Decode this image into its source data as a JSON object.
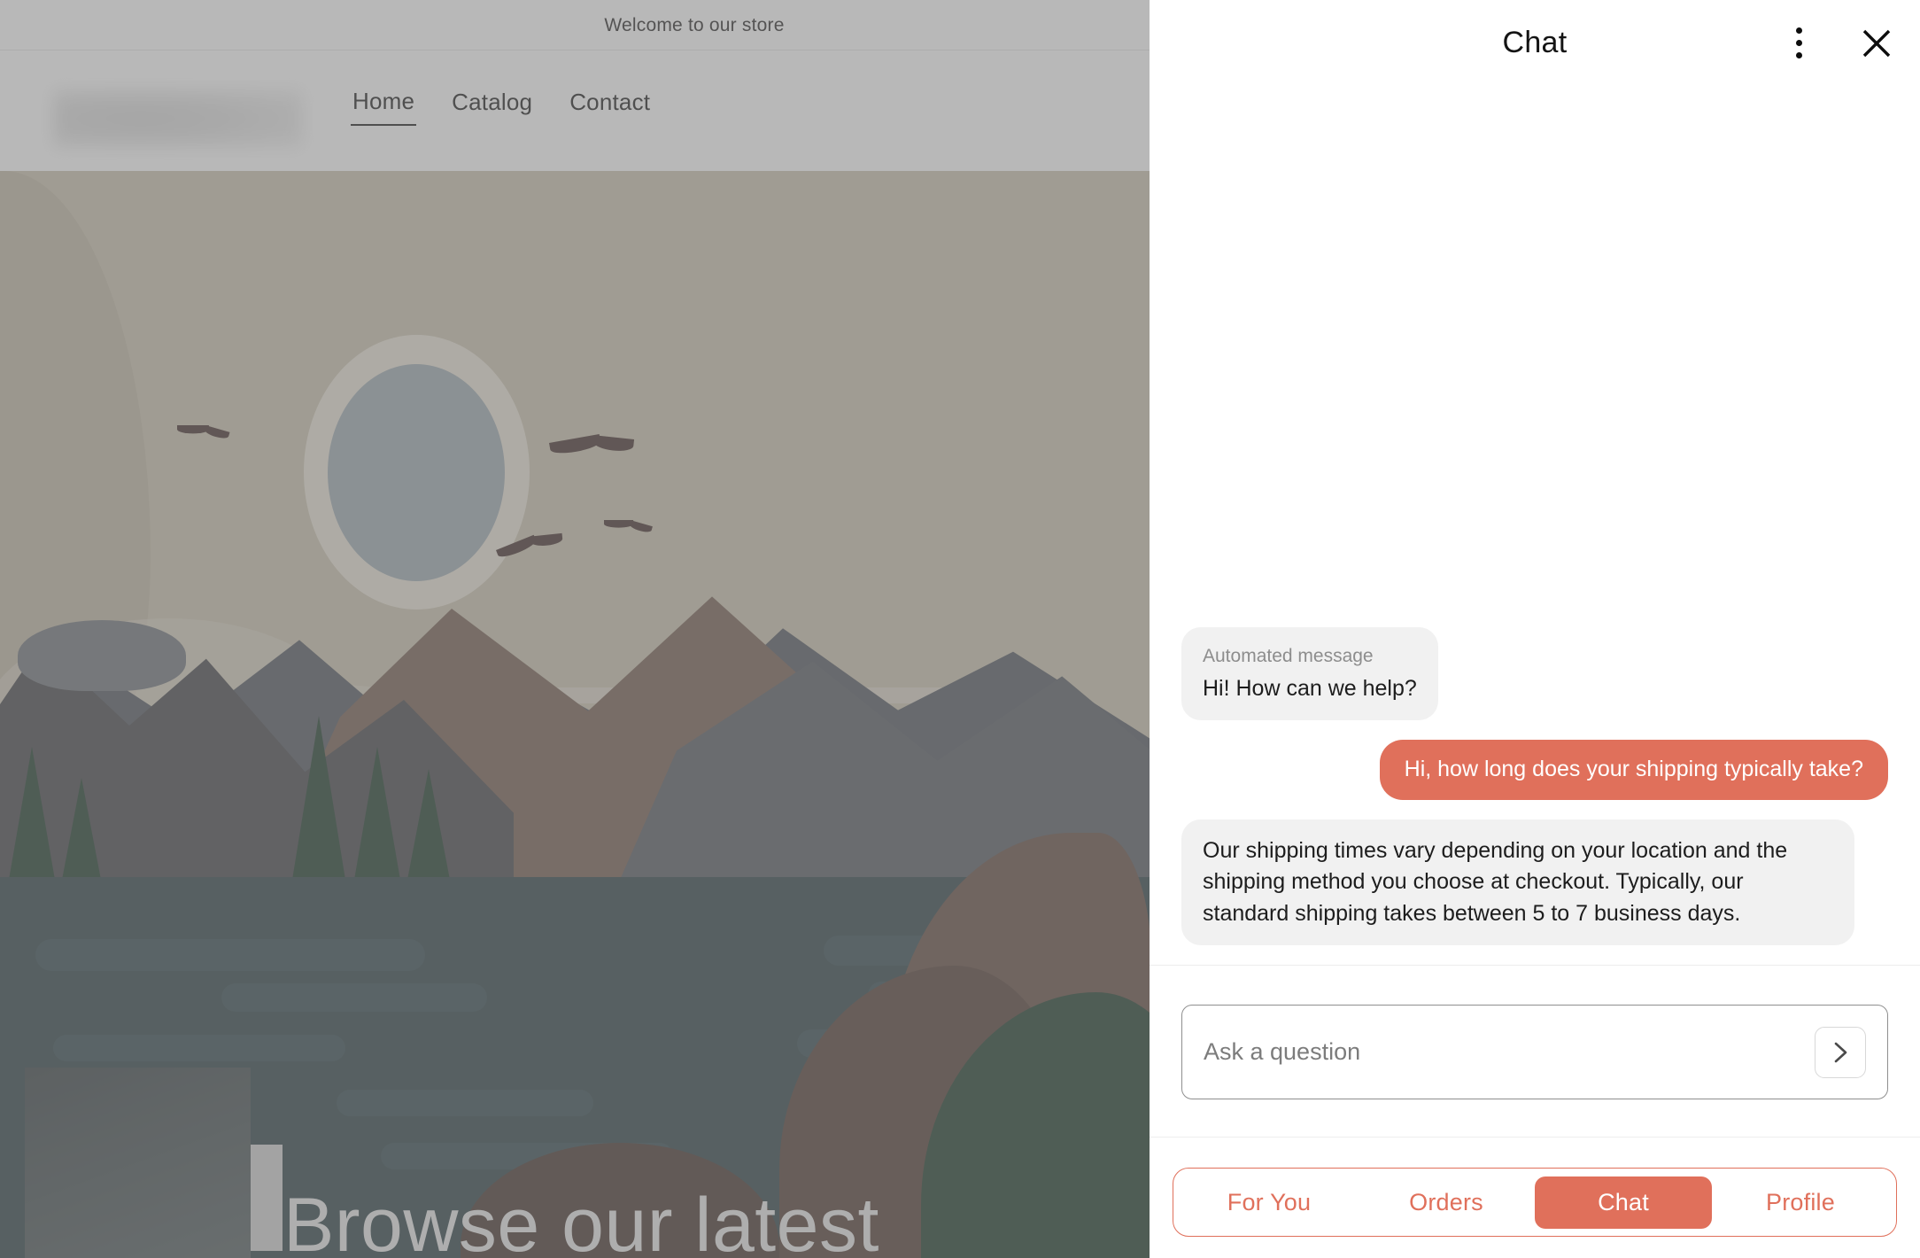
{
  "store": {
    "announcement": "Welcome to our store",
    "nav": [
      {
        "label": "Home",
        "active": true
      },
      {
        "label": "Catalog",
        "active": false
      },
      {
        "label": "Contact",
        "active": false
      }
    ],
    "hero_heading": "Browse our latest"
  },
  "chat": {
    "title": "Chat",
    "menu_icon": "more-vertical-icon",
    "close_icon": "close-icon",
    "messages": [
      {
        "author": "bot",
        "meta": "Automated message",
        "text": "Hi! How can we help?"
      },
      {
        "author": "user",
        "meta": "",
        "text": "Hi, how long does your shipping typically take?"
      },
      {
        "author": "bot",
        "meta": "",
        "text": "Our shipping times vary depending on your location and the shipping method you choose at checkout. Typically, our standard shipping takes between 5 to 7 business days."
      }
    ],
    "composer": {
      "value": "",
      "placeholder": "Ask a question",
      "send_icon": "chevron-right-icon"
    },
    "tabs": [
      {
        "label": "For You",
        "active": false
      },
      {
        "label": "Orders",
        "active": false
      },
      {
        "label": "Chat",
        "active": true
      },
      {
        "label": "Profile",
        "active": false
      }
    ]
  },
  "colors": {
    "accent": "#e0705b",
    "bot_bubble": "#f1f1f1",
    "panel_bg": "#ffffff",
    "overlay": "rgba(128,128,128,0.56)"
  }
}
